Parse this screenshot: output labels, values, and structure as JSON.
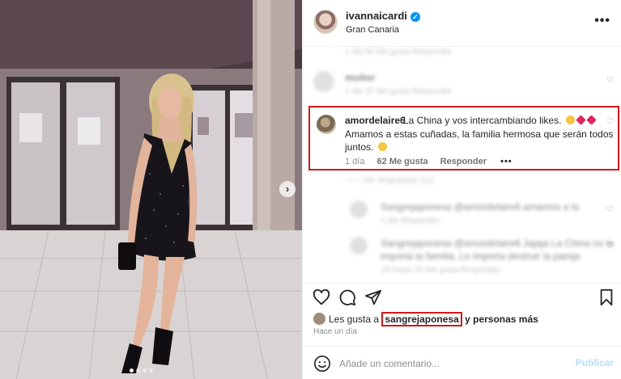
{
  "post": {
    "username": "ivannaicardi",
    "location": "Gran Canaria",
    "more_icon": "ellipsis-icon",
    "verified_icon": "verified-badge-icon"
  },
  "comments": {
    "top_partial_meta": "1 día   56 Me gusta   Responder",
    "blur1_user": "muitor",
    "blur1_meta": "1 día   37 Me gusta   Responder",
    "highlighted": {
      "username": "amordelaire6",
      "text_line1": "La China y vos intercambiando likes.",
      "text_line2": "Amamos a estas cuñadas, la familia hermosa que serán todos",
      "text_line3": "juntos.",
      "time": "1 día",
      "likes": "62 Me gusta",
      "reply": "Responder",
      "more": "•••"
    },
    "replies_toggle": "—— Ver respuestas (11)",
    "blur2_text": "Sangrejaponesa @amordelaire6 amamos a la",
    "blur2_meta": "1 día   Responder",
    "blur3_text_line1": "Sangrejaponesa @amordelaire6 Jajaja La China no le",
    "blur3_text_line2": "importa la familia. Le importa destruir la pareja",
    "blur3_meta": "23 horas   20 Me gusta   Responder"
  },
  "actions": {
    "like_icon": "heart-icon",
    "comment_icon": "comment-icon",
    "share_icon": "send-icon",
    "save_icon": "bookmark-icon"
  },
  "likes": {
    "prefix": "Les gusta a ",
    "liker": "sangrejaponesa",
    "suffix": " y personas más",
    "time": "Hace un día"
  },
  "composer": {
    "placeholder": "Añade un comentario...",
    "publish": "Publicar",
    "emoji_icon": "emoji-icon"
  },
  "colors": {
    "highlight_border": "#d11a1a",
    "verified": "#0095f6",
    "publish_disabled": "#b2dffc"
  },
  "carousel": {
    "next_icon": "chevron-right-icon",
    "slide_count": 4,
    "active_slide": 1
  }
}
